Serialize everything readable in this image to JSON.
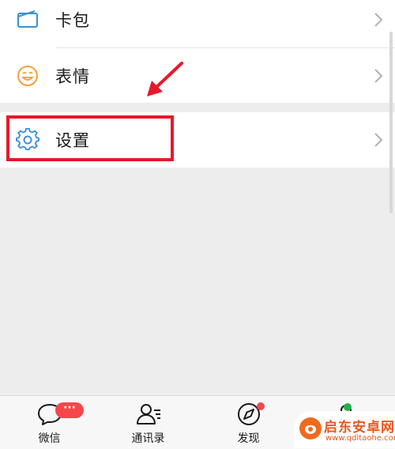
{
  "menu": {
    "items": [
      {
        "label": "卡包",
        "icon": "card-wallet-icon"
      },
      {
        "label": "表情",
        "icon": "emoji-icon"
      },
      {
        "label": "设置",
        "icon": "gear-icon"
      }
    ]
  },
  "tabbar": {
    "tabs": [
      {
        "label": "微信",
        "icon": "chat-icon"
      },
      {
        "label": "通讯录",
        "icon": "contacts-icon"
      },
      {
        "label": "发现",
        "icon": "compass-icon"
      }
    ],
    "chat_badge": "···"
  },
  "colors": {
    "highlight": "#e6192a",
    "badge": "#f5474b",
    "online_dot": "#21b24c",
    "gear_icon": "#3b8fd9",
    "emoji_icon": "#f0a23b"
  },
  "watermark": {
    "title": "启东安卓网",
    "url": "www.qdltaohe.com"
  }
}
